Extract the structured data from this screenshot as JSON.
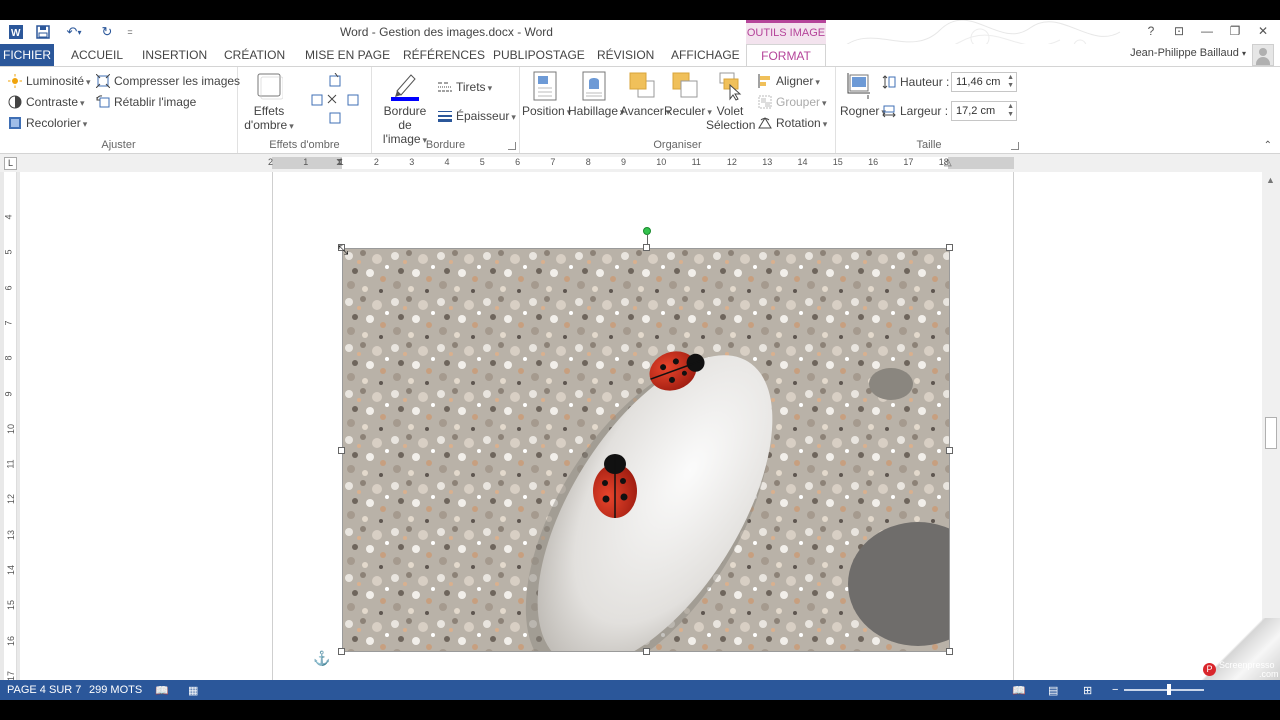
{
  "window": {
    "title": "Word - Gestion des images.docx - Word",
    "contextual_tab_group": "OUTILS IMAGE",
    "user_name": "Jean-Philippe Baillaud",
    "help": "?",
    "qat_customize": "="
  },
  "tabs": [
    {
      "label": "FICHIER"
    },
    {
      "label": "ACCUEIL"
    },
    {
      "label": "INSERTION"
    },
    {
      "label": "CRÉATION"
    },
    {
      "label": "MISE EN PAGE"
    },
    {
      "label": "RÉFÉRENCES"
    },
    {
      "label": "PUBLIPOSTAGE"
    },
    {
      "label": "RÉVISION"
    },
    {
      "label": "AFFICHAGE"
    },
    {
      "label": "FORMAT"
    }
  ],
  "ribbon": {
    "ajuster": {
      "label": "Ajuster",
      "luminosite": "Luminosité",
      "contraste": "Contraste",
      "recolorier": "Recolorier",
      "compresser": "Compresser les images",
      "retablir": "Rétablir l'image"
    },
    "effets": {
      "label": "Effets d'ombre",
      "button_line1": "Effets",
      "button_line2": "d'ombre"
    },
    "bordure": {
      "label": "Bordure",
      "bordure_line1": "Bordure de",
      "bordure_line2": "l'image",
      "tirets": "Tirets",
      "epaisseur": "Épaisseur",
      "border_color": "#0000ff"
    },
    "organiser": {
      "label": "Organiser",
      "position": "Position",
      "habillage": "Habillage",
      "avancer": "Avancer",
      "reculer": "Reculer",
      "volet_line1": "Volet",
      "volet_line2": "Sélection",
      "aligner": "Aligner",
      "grouper": "Grouper",
      "rotation": "Rotation"
    },
    "taille": {
      "label": "Taille",
      "rogner": "Rogner",
      "hauteur_label": "Hauteur :",
      "hauteur_value": "11,46 cm",
      "largeur_label": "Largeur :",
      "largeur_value": "17,2 cm"
    }
  },
  "ruler": {
    "corner": "L",
    "h_numbers": [
      "2",
      "1",
      "1",
      "2",
      "3",
      "4",
      "5",
      "6",
      "7",
      "8",
      "9",
      "10",
      "11",
      "12",
      "13",
      "14",
      "15",
      "16",
      "17",
      "18"
    ],
    "v_numbers": [
      "4",
      "5",
      "6",
      "7",
      "8",
      "9",
      "10",
      "11",
      "12",
      "13",
      "14",
      "15",
      "16",
      "17"
    ]
  },
  "status": {
    "page": "PAGE 4 SUR 7",
    "words": "299 MOTS"
  },
  "watermark": {
    "line1": "Screenpresso",
    "line2": ".com"
  },
  "colors": {
    "brand_blue": "#2b579a",
    "format_accent": "#b5449a"
  }
}
